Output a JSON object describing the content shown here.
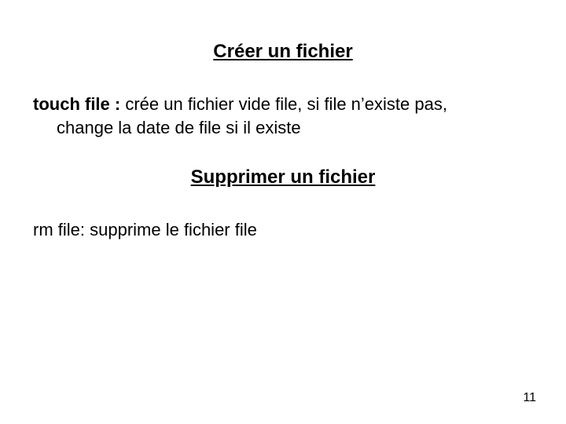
{
  "heading1": "Créer un fichier",
  "para1": {
    "cmd": "touch file :",
    "tail": "  crée un fichier vide file, si file n’existe pas,",
    "line2": "change la date de file si il existe"
  },
  "heading2": "Supprimer un fichier",
  "para2": "rm file:  supprime le fichier file",
  "page_number": "11"
}
